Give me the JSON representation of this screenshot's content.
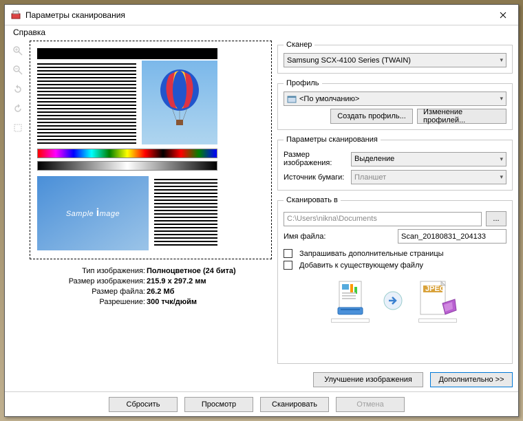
{
  "window": {
    "title": "Параметры сканирования"
  },
  "menu": {
    "help": "Справка"
  },
  "info": {
    "image_type_label": "Тип изображения:",
    "image_type_value": "Полноцветное (24 бита)",
    "image_size_label": "Размер изображения:",
    "image_size_value": "215.9 x 297.2 мм",
    "file_size_label": "Размер файла:",
    "file_size_value": "26.2 Мб",
    "resolution_label": "Разрешение:",
    "resolution_value": "300 тчк/дюйм"
  },
  "scanner": {
    "legend": "Сканер",
    "selected": "Samsung SCX-4100 Series (TWAIN)"
  },
  "profile": {
    "legend": "Профиль",
    "selected": "<По умолчанию>",
    "create_btn": "Создать профиль...",
    "edit_btn": "Изменение профилей..."
  },
  "scan_params": {
    "legend": "Параметры сканирования",
    "image_size_label": "Размер изображения:",
    "image_size_value": "Выделение",
    "paper_source_label": "Источник бумаги:",
    "paper_source_value": "Планшет"
  },
  "scan_to": {
    "legend": "Сканировать в",
    "path": "C:\\Users\\nikna\\Documents",
    "browse": "...",
    "filename_label": "Имя файла:",
    "filename_value": "Scan_20180831_204133",
    "ask_more": "Запрашивать дополнительные страницы",
    "append": "Добавить к существующему файлу",
    "format_badge": "JPEG"
  },
  "buttons": {
    "enhance": "Улучшение изображения",
    "advanced": "Дополнительно >>",
    "reset": "Сбросить",
    "preview": "Просмотр",
    "scan": "Сканировать",
    "cancel": "Отмена"
  },
  "preview": {
    "sample_text": "Sample ",
    "sample_i": "i",
    "sample_rest": "mage"
  }
}
